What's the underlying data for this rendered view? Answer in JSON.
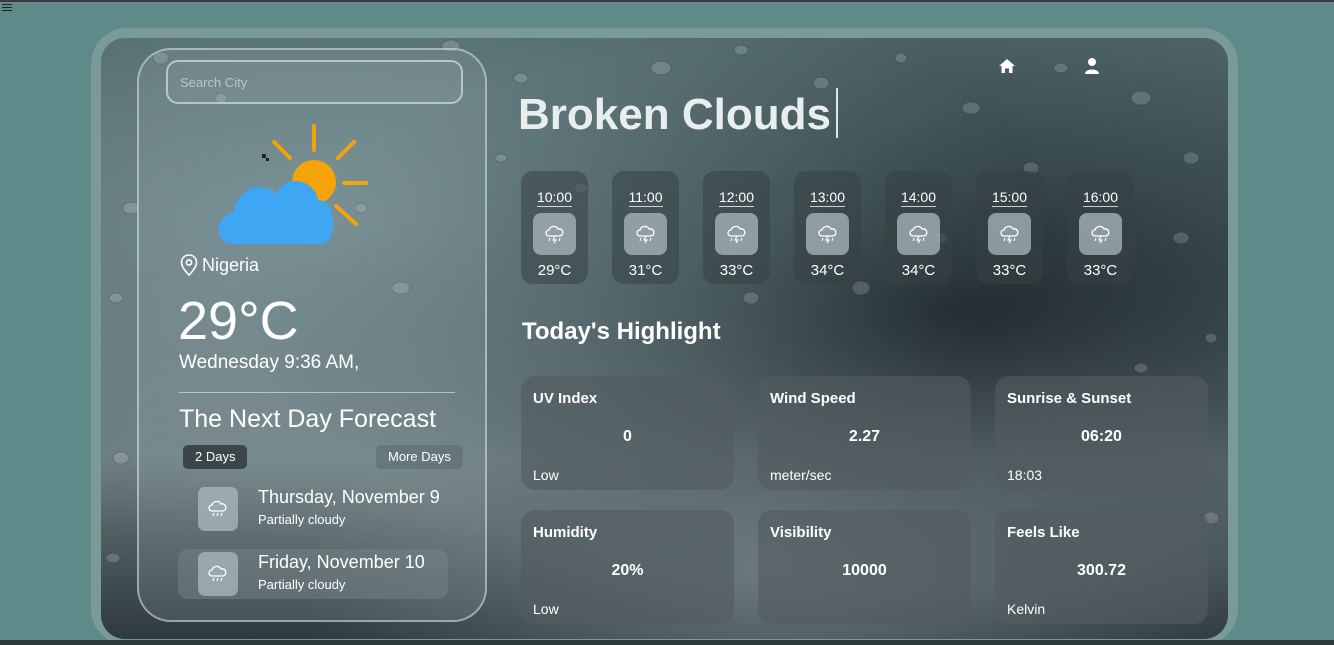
{
  "search": {
    "placeholder": "Search City"
  },
  "current": {
    "location": "Nigeria",
    "temperature": "29°C",
    "datetime": "Wednesday 9:36 AM,",
    "condition": "Broken Clouds"
  },
  "forecast": {
    "title": "The Next Day Forecast",
    "tab_active": "2 Days",
    "tab_more": "More Days",
    "days": [
      {
        "name": "Thursday, November 9",
        "desc": "Partially cloudy",
        "icon": "rain-cloud-icon"
      },
      {
        "name": "Friday, November 10",
        "desc": "Partially cloudy",
        "icon": "rain-cloud-icon"
      }
    ]
  },
  "hourly": [
    {
      "time": "10:00",
      "temp": "29°C",
      "icon": "thunderstorm-icon"
    },
    {
      "time": "11:00",
      "temp": "31°C",
      "icon": "thunderstorm-icon"
    },
    {
      "time": "12:00",
      "temp": "33°C",
      "icon": "thunderstorm-icon"
    },
    {
      "time": "13:00",
      "temp": "34°C",
      "icon": "thunderstorm-icon"
    },
    {
      "time": "14:00",
      "temp": "34°C",
      "icon": "thunderstorm-icon"
    },
    {
      "time": "15:00",
      "temp": "33°C",
      "icon": "thunderstorm-icon"
    },
    {
      "time": "16:00",
      "temp": "33°C",
      "icon": "thunderstorm-icon"
    }
  ],
  "highlight": {
    "title": "Today's Highlight",
    "cards": [
      {
        "label": "UV Index",
        "value": "0",
        "sub": "Low"
      },
      {
        "label": "Wind Speed",
        "value": "2.27",
        "sub": "meter/sec"
      },
      {
        "label": "Sunrise & Sunset",
        "value": "06:20",
        "sub": "18:03"
      },
      {
        "label": "Humidity",
        "value": "20%",
        "sub": "Low"
      },
      {
        "label": "Visibility",
        "value": "10000",
        "sub": ""
      },
      {
        "label": "Feels Like",
        "value": "300.72",
        "sub": "Kelvin"
      }
    ]
  },
  "nav": {
    "home_icon": "home-icon",
    "user_icon": "user-icon"
  },
  "colors": {
    "sun": "#f5a30a",
    "cloud": "#3ea6f2",
    "page_bg": "#5f8a8a"
  }
}
